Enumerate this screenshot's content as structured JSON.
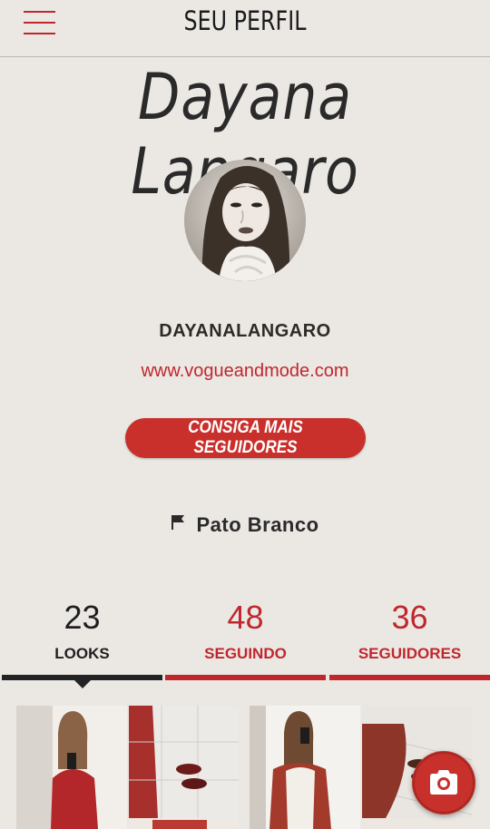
{
  "header": {
    "title": "SEU PERFIL",
    "menu_icon": "hamburger-menu-icon"
  },
  "profile": {
    "display_name": "Dayana Langaro",
    "username": "DAYANALANGARO",
    "website": "www.vogueandmode.com",
    "cta_label": "CONSIGA MAIS SEGUIDORES",
    "location_icon": "flag-icon",
    "location": "Pato Branco"
  },
  "stats": [
    {
      "count": "23",
      "label": "LOOKS",
      "active": true
    },
    {
      "count": "48",
      "label": "SEGUINDO",
      "active": false
    },
    {
      "count": "36",
      "label": "SEGUIDORES",
      "active": false
    }
  ],
  "colors": {
    "accent": "#c0272d",
    "background": "#ebe8e4",
    "text": "#1f1f1f"
  },
  "camera_icon": "camera-icon"
}
